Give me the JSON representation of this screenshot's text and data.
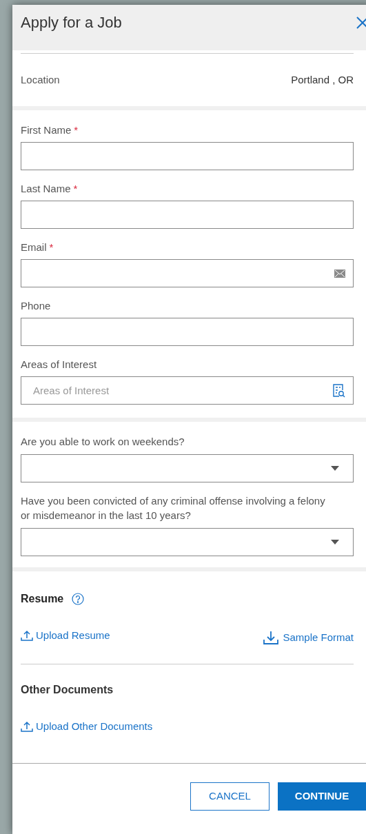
{
  "dialog": {
    "title": "Apply for a Job"
  },
  "location": {
    "label": "Location",
    "value": "Portland , OR"
  },
  "fields": [
    {
      "kind": "text",
      "label": "First Name",
      "required_mark": "*"
    },
    {
      "kind": "text",
      "label": "Last Name",
      "required_mark": "*"
    },
    {
      "kind": "email",
      "label": "Email",
      "required_mark": "*"
    },
    {
      "kind": "text",
      "label": "Phone"
    },
    {
      "kind": "search",
      "label": "Areas of Interest",
      "placeholder": "Areas of Interest"
    }
  ],
  "questions": [
    {
      "kind": "select",
      "label": "Are you able to work on weekends?"
    },
    {
      "kind": "select",
      "label": "Have you been convicted of any criminal offense involving a felony or misdemeanor in the last 10 years?"
    }
  ],
  "resume": {
    "title": "Resume",
    "upload": "Upload Resume",
    "sample": "Sample Format"
  },
  "other_documents": {
    "title": "Other Documents",
    "upload": "Upload Other Documents"
  },
  "buttons": [
    {
      "kind": "secondary",
      "label": "CANCEL"
    },
    {
      "kind": "primary",
      "label": "CONTINUE"
    }
  ]
}
